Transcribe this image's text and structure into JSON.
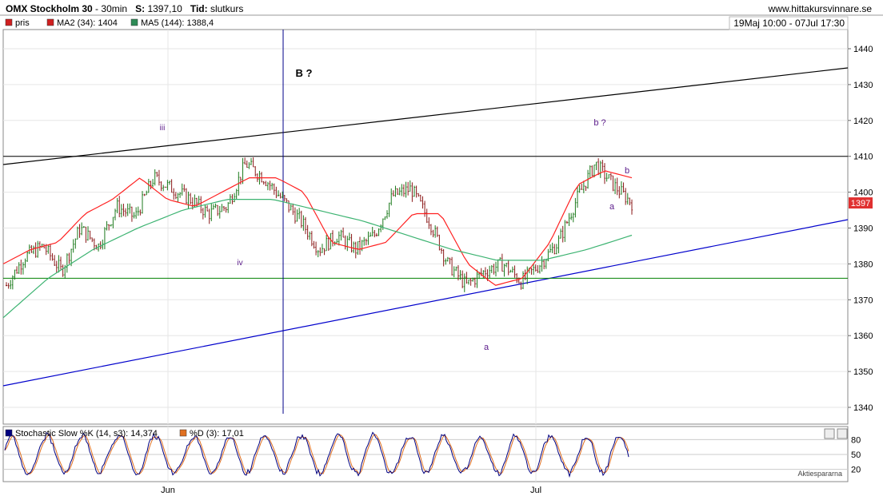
{
  "header": {
    "instrument": "OMX Stockholm 30",
    "sep": "-",
    "interval": "30min",
    "last_label": "S:",
    "last_value": "1397,10",
    "time_label": "Tid:",
    "time_value": "slutkurs",
    "site": "www.hittakursvinnare.se",
    "range": "19Maj 10:00 - 07Jul 17:30"
  },
  "legend": [
    {
      "label": "pris",
      "color": "#d02020"
    },
    {
      "label": "MA2 (34): 1404",
      "color": "#d02020"
    },
    {
      "label": "MA5 (144): 1388,4",
      "color": "#2e8b57"
    }
  ],
  "stoch_legend": [
    {
      "label": "Stochastic Slow %K (14, s3): 14,374",
      "color": "#000080"
    },
    {
      "label": "%D (3): 17,01",
      "color": "#e07020"
    }
  ],
  "colors": {
    "ma34": "#ff2020",
    "ma144": "#3cb371",
    "up": "#1c7a1c",
    "down": "#8b1a1a",
    "trend_blue": "#0000cc",
    "support": "#008000",
    "stoch_k": "#000080",
    "stoch_d": "#e07020",
    "last_price_bg": "#e03030"
  },
  "last_price_tag": "1397",
  "watermark": "Aktiespararna",
  "chart_data": {
    "type": "candlestick",
    "y_ticks": [
      1340,
      1350,
      1360,
      1370,
      1380,
      1390,
      1400,
      1410,
      1420,
      1430,
      1440
    ],
    "ylim": [
      1333,
      1448
    ],
    "x_labels": [
      "Jun",
      "Jul"
    ],
    "stoch_ticks": [
      20,
      50,
      80
    ],
    "annotations": [
      {
        "text": "B ?",
        "date": "2015-06-09"
      },
      {
        "text": "iii",
        "date": "2015-05-28"
      },
      {
        "text": "iv",
        "date": "2015-06-05"
      },
      {
        "text": "b ?",
        "date": "2015-07-06"
      },
      {
        "text": "b",
        "date": "2015-07-07"
      },
      {
        "text": "a",
        "date": "2015-07-07"
      },
      {
        "text": "a",
        "date": "2015-06-26"
      }
    ],
    "horizontal_lines": [
      1410,
      1376
    ],
    "vertical_line_date": "2015-06-09",
    "series": [
      {
        "name": "pris",
        "key_closes": [
          1374,
          1382,
          1385,
          1378,
          1390,
          1385,
          1396,
          1393,
          1404,
          1401,
          1398,
          1394,
          1396,
          1408,
          1404,
          1398,
          1392,
          1384,
          1388,
          1384,
          1388,
          1399,
          1401,
          1392,
          1380,
          1374,
          1378,
          1380,
          1375,
          1380,
          1386,
          1398,
          1408,
          1402,
          1397
        ]
      },
      {
        "name": "MA2 (34)",
        "values": [
          1380,
          1384,
          1386,
          1394,
          1398,
          1404,
          1398,
          1396,
          1400,
          1404,
          1404,
          1400,
          1386,
          1384,
          1386,
          1394,
          1394,
          1380,
          1374,
          1376,
          1386,
          1402,
          1406,
          1404
        ]
      },
      {
        "name": "MA5 (144)",
        "values": [
          1365,
          1376,
          1384,
          1390,
          1395,
          1398,
          1398,
          1395,
          1392,
          1388,
          1384,
          1381,
          1381,
          1384,
          1388
        ]
      },
      {
        "name": "Stochastic Slow %K"
      },
      {
        "name": "%D"
      }
    ]
  }
}
